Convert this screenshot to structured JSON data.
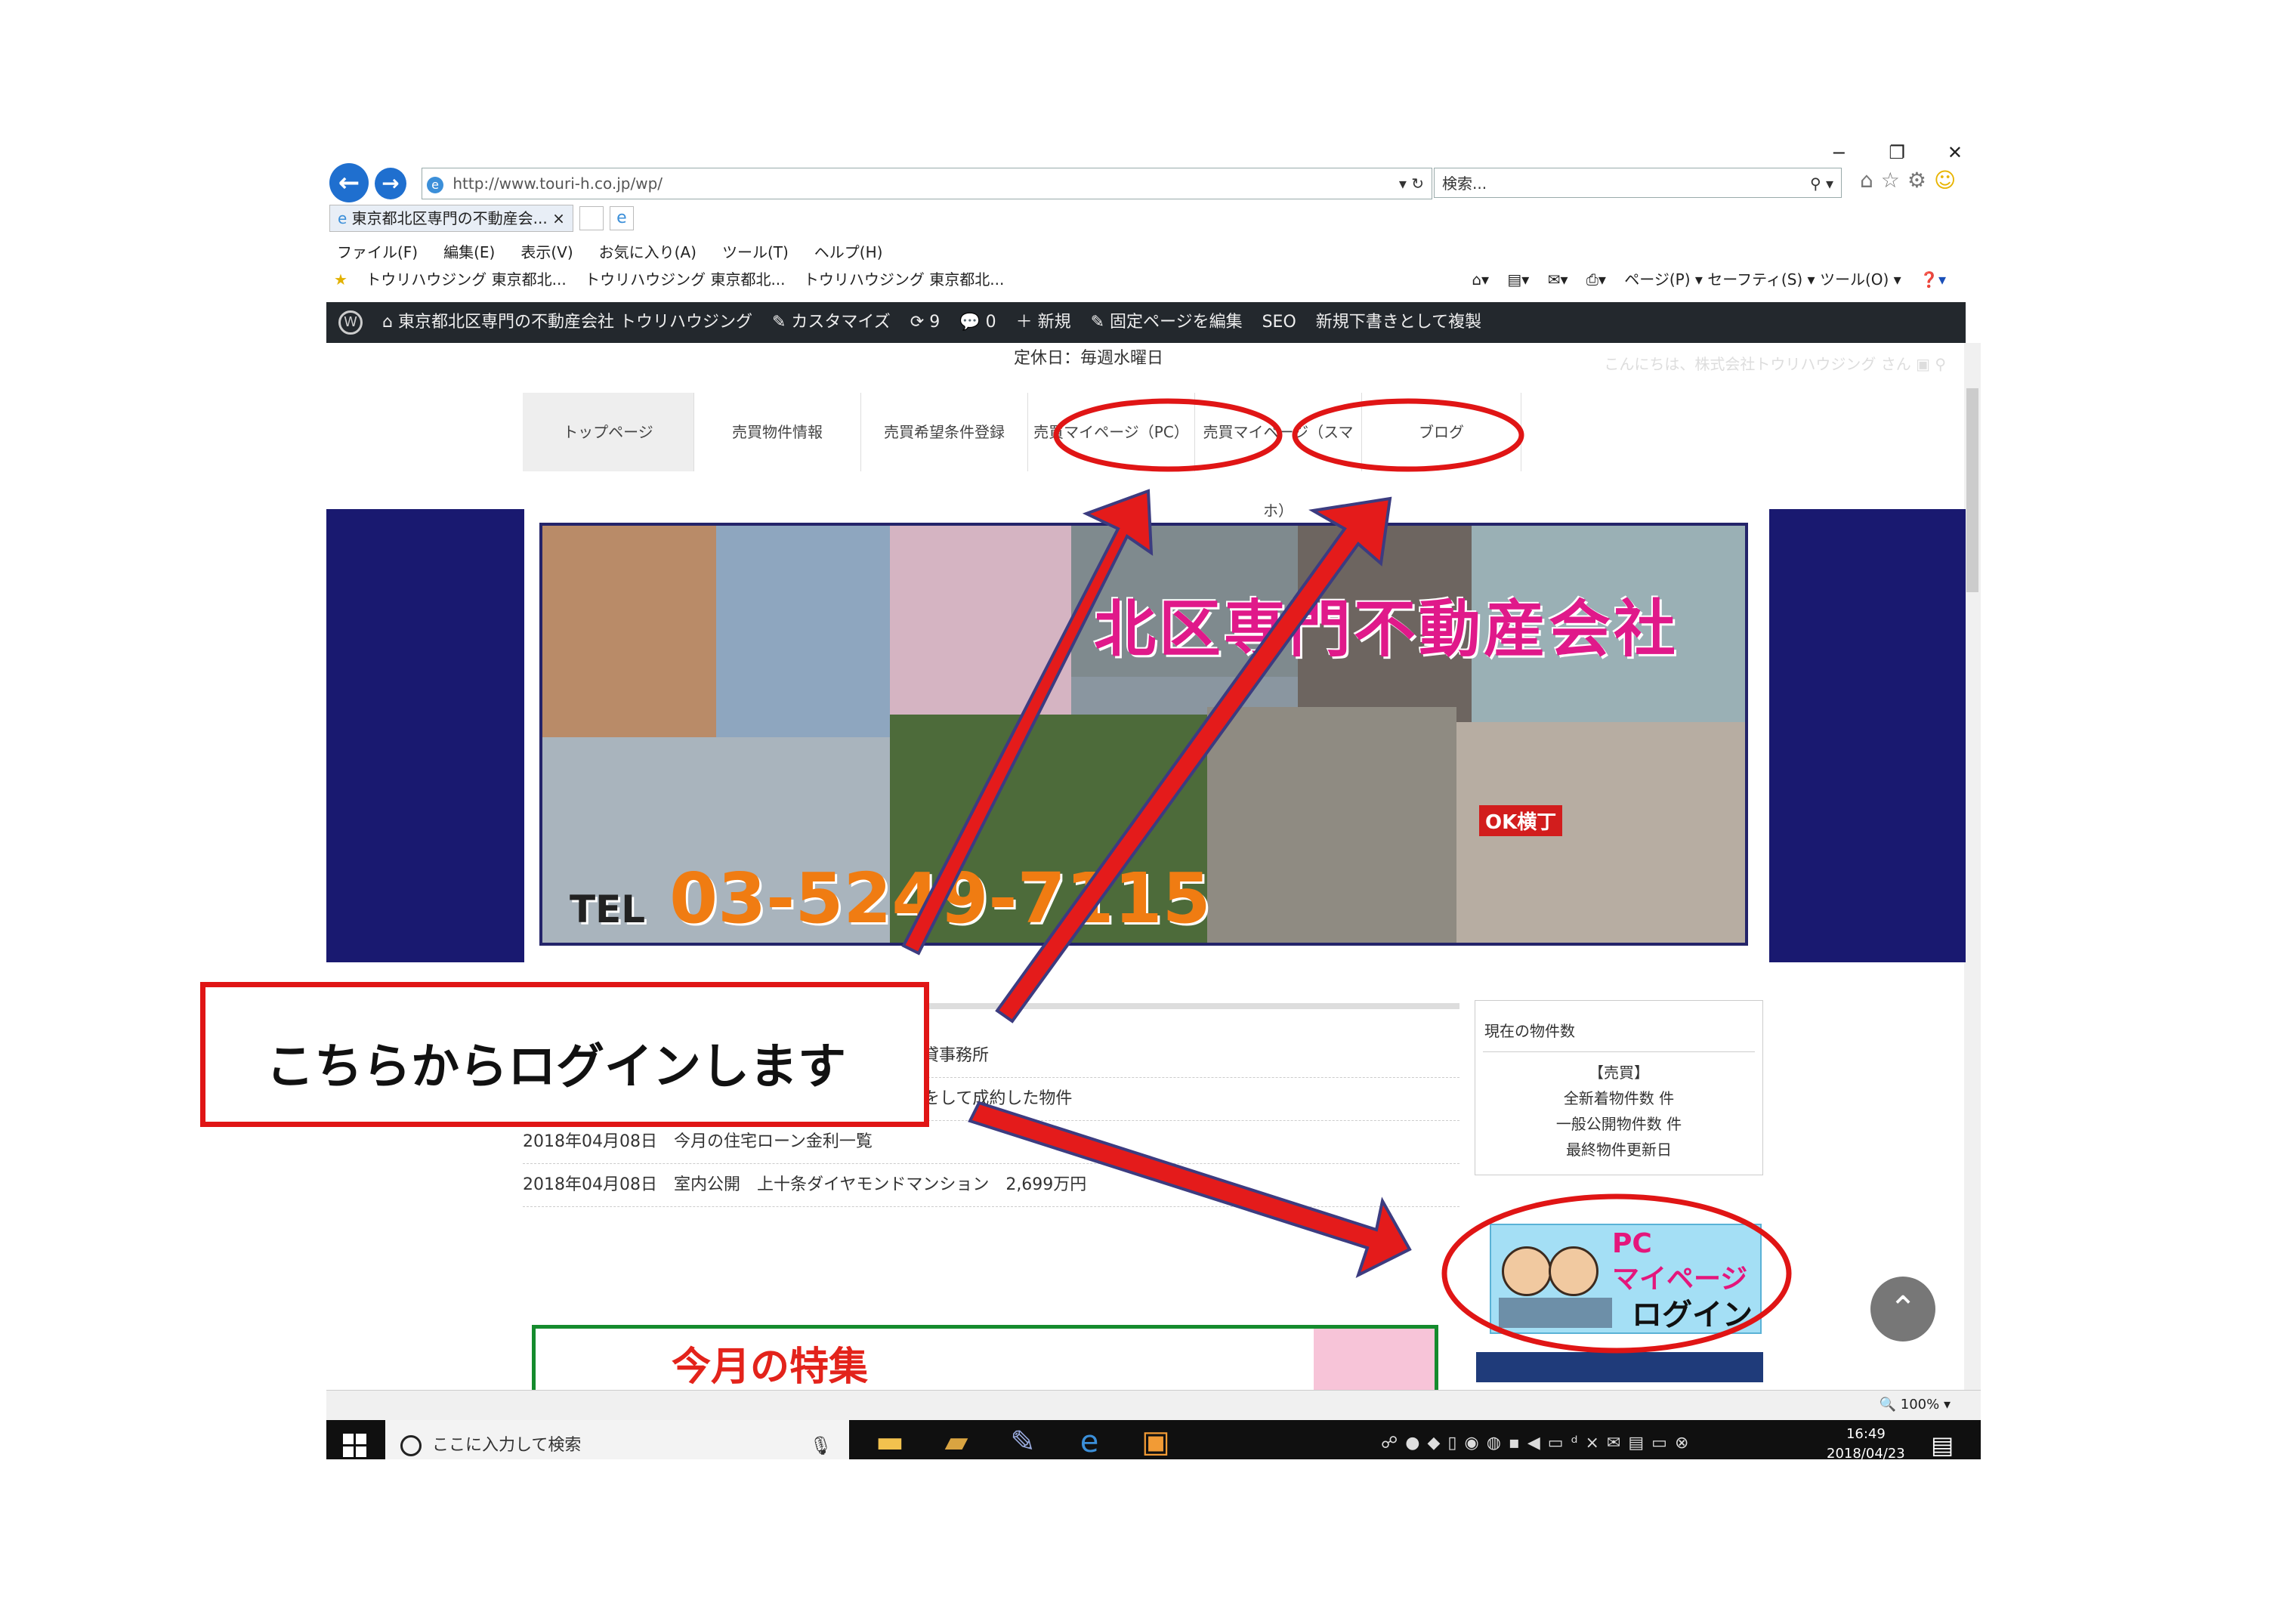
{
  "browser": {
    "url": "http://www.touri-h.co.jp/wp/",
    "search_placeholder": "検索...",
    "tab_title": "東京都北区専門の不動産会...",
    "tab_close": "×",
    "menu": [
      "ファイル(F)",
      "編集(E)",
      "表示(V)",
      "お気に入り(A)",
      "ツール(T)",
      "ヘルプ(H)"
    ],
    "favorites": [
      "トウリハウジング 東京都北...",
      "トウリハウジング 東京都北...",
      "トウリハウジング 東京都北..."
    ],
    "command_bar": "ページ(P) ▾  セーフティ(S) ▾  ツール(O) ▾",
    "window_controls": [
      "−",
      "❐",
      "✕"
    ],
    "zoom": "100%"
  },
  "wp_admin_bar": {
    "site_name": "東京都北区専門の不動産会社 トウリハウジング",
    "customize": "カスタマイズ",
    "updates_count": "9",
    "comments_count": "0",
    "new": "新規",
    "edit_page": "固定ページを編集",
    "seo": "SEO",
    "copy_draft": "新規下書きとして複製"
  },
  "site": {
    "holiday": "定休日：毎週水曜日",
    "greeting": "こんにちは、株式会社トウリハウジング さん",
    "nav": [
      "トップページ",
      "売買物件情報",
      "売買希望条件登録",
      "売買マイページ（PC）",
      "売買マイページ（スマホ）",
      "ブログ"
    ],
    "banner_title": "北区専門不動産会社",
    "banner_tel_prefix": "TEL",
    "banner_tel": "03-5249-7115",
    "banner_sign": "OK横丁",
    "news": [
      "2018年04月12日　室内公開　賃貸物件　赤羽2丁目 貸事務所",
      "2018年04月21日　これから販売する物件と販売活動をして成約した物件",
      "2018年04月08日　今月の住宅ローン金利一覧",
      "2018年04月08日　室内公開　上十条ダイヤモンドマンション　2,699万円"
    ],
    "feature_title": "今月の特集",
    "sidebar": {
      "count_heading": "現在の物件数",
      "lines": [
        "【売買】",
        "全新着物件数 件",
        "一般公開物件数 件",
        "最終物件更新日"
      ]
    },
    "pc_login": {
      "line1": "PC",
      "line2": "マイページ",
      "line3": "ログイン"
    }
  },
  "taskbar": {
    "search_placeholder": "ここに入力して検索",
    "time": "16:49",
    "date": "2018/04/23"
  },
  "annotation": {
    "callout_text": "こちらからログインします",
    "accent_color": "#e01515"
  }
}
